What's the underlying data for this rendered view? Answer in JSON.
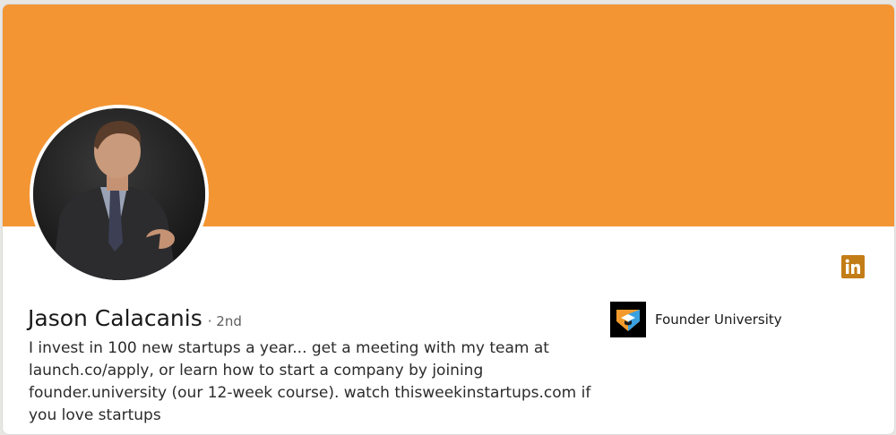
{
  "profile": {
    "name": "Jason Calacanis",
    "degree": "· 2nd",
    "headline": "I invest in 100 new startups a year... get a meeting with my team at launch.co/apply, or learn how to start a company by joining founder.university (our 12-week course). watch thisweekinstartups.com if you love startups",
    "avatar_icon": "profile-photo"
  },
  "company": {
    "name": "Founder University",
    "logo_icon": "founder-university-logo"
  },
  "badge": {
    "icon": "linkedin-icon",
    "label": "in"
  },
  "colors": {
    "banner": "#f39533",
    "linkedin_badge": "#c37d16",
    "text_primary": "#191919",
    "text_secondary": "#5e5e5e"
  }
}
